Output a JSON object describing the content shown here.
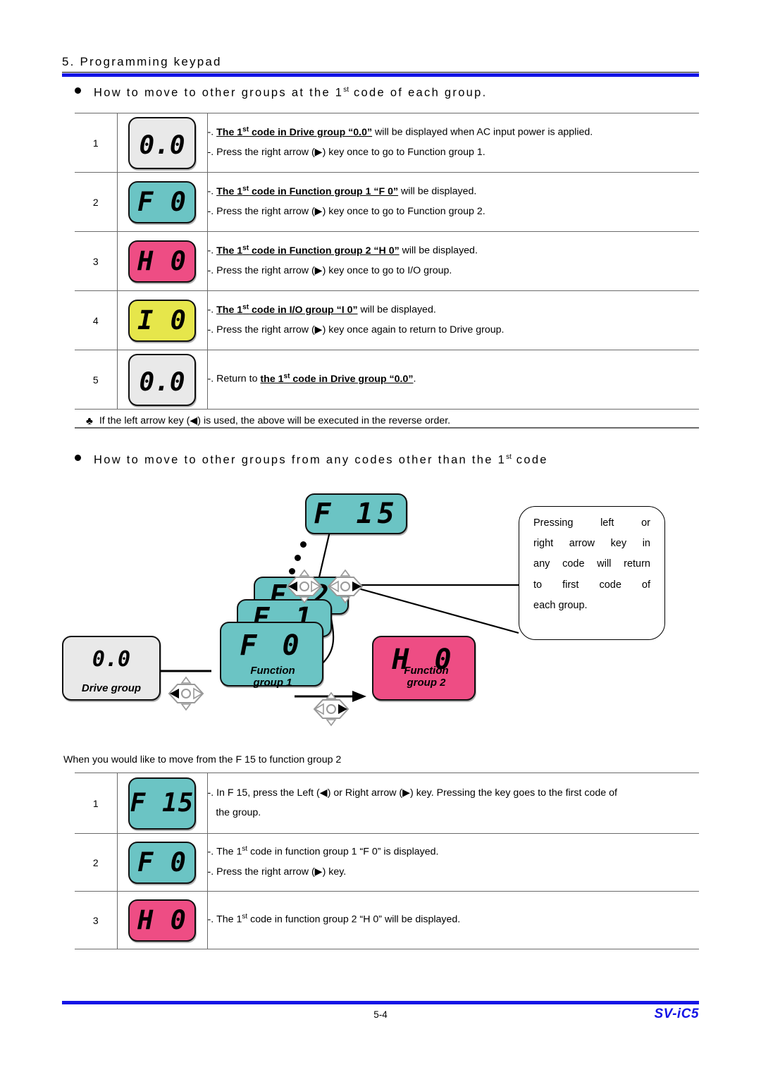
{
  "header": {
    "title": "5. Programming keypad"
  },
  "section1": {
    "heading_pre": "How to move to other groups at the 1",
    "heading_sup": "st",
    "heading_post": " code of each group.",
    "rows": [
      {
        "num": "1",
        "display": {
          "text": "0.0",
          "color": "gray",
          "style": "double"
        },
        "lines": [
          {
            "bold": "The 1st code in Drive group “0.0”",
            "rest": " will be displayed when AC input power is applied.",
            "prefix": "-. "
          },
          {
            "bold": "",
            "rest": "Press the right arrow (▶) key once to go to Function group 1.",
            "prefix": "-. "
          }
        ]
      },
      {
        "num": "2",
        "display": {
          "text": "F 0",
          "color": "teal",
          "style": "single"
        },
        "lines": [
          {
            "bold": "The 1st code in Function group 1 “F 0”",
            "rest": " will be displayed.",
            "prefix": "-. "
          },
          {
            "bold": "",
            "rest": "Press the right arrow (▶) key once to go to Function group 2.",
            "prefix": "-. "
          }
        ]
      },
      {
        "num": "3",
        "display": {
          "text": "H 0",
          "color": "pink",
          "style": "single"
        },
        "lines": [
          {
            "bold": "The 1st code in Function group 2 “H 0”",
            "rest": " will be displayed.",
            "prefix": "-. "
          },
          {
            "bold": "",
            "rest": "Press the right arrow (▶) key once to go to I/O group.",
            "prefix": "-. "
          }
        ]
      },
      {
        "num": "4",
        "display": {
          "text": "I 0",
          "color": "yellow",
          "style": "single"
        },
        "lines": [
          {
            "bold": "The 1st code in I/O group “I 0”",
            "rest": " will be displayed.",
            "prefix": "-. "
          },
          {
            "bold": "",
            "rest": "Press the right arrow (▶) key once again to return to Drive group.",
            "prefix": "-. "
          }
        ]
      },
      {
        "num": "5",
        "display": {
          "text": "0.0",
          "color": "gray",
          "style": "double"
        },
        "lines": [
          {
            "bold": "the 1st code in Drive group “0.0”",
            "rest": ".",
            "prefix": "-. Return to "
          }
        ]
      }
    ],
    "note": {
      "symbol": "♣",
      "text": "If the left arrow key (◀) is used, the above will be executed in the reverse order."
    }
  },
  "section2": {
    "heading_pre": "How to move to other groups from any codes other than the 1",
    "heading_sup": "st",
    "heading_post": " code",
    "diagram": {
      "f15": {
        "text": "F 15",
        "color": "teal"
      },
      "f2": {
        "text": "F 2",
        "color": "teal"
      },
      "f1": {
        "text": "F 1",
        "color": "teal"
      },
      "f0": {
        "text": "F 0",
        "color": "teal",
        "label1": "Function",
        "label2": "group 1"
      },
      "drive": {
        "text": "0.0",
        "color": "gray",
        "label1": "Drive group"
      },
      "h0": {
        "text": "H 0",
        "color": "pink",
        "label1": "Function",
        "label2": "group 2"
      },
      "callout": [
        "Pressing left or",
        "right arrow key in",
        "any code will return",
        "to first code of",
        "each group."
      ]
    },
    "caption": "When you would like to move from the F 15 to function group 2",
    "rows": [
      {
        "num": "1",
        "display": {
          "text": "F 15",
          "color": "teal",
          "style": "single"
        },
        "lines": [
          {
            "bold": "",
            "rest": "In F 15, press the Left (◀) or Right arrow (▶) key. Pressing the key goes to the first code of",
            "prefix": "-. "
          },
          {
            "bold": "",
            "rest": "the group.",
            "prefix": "   "
          }
        ]
      },
      {
        "num": "2",
        "display": {
          "text": "F 0",
          "color": "teal",
          "style": "single"
        },
        "lines": [
          {
            "bold": "",
            "rest": "The 1st code in function group 1 “F 0” is displayed.",
            "prefix": "-. "
          },
          {
            "bold": "",
            "rest": "Press the right arrow (▶) key.",
            "prefix": "-. "
          }
        ]
      },
      {
        "num": "3",
        "display": {
          "text": "H 0",
          "color": "pink",
          "style": "single"
        },
        "lines": [
          {
            "bold": "",
            "rest": "The 1st code in function group 2 “H 0” will be displayed.",
            "prefix": "-. "
          }
        ]
      }
    ]
  },
  "footer": {
    "page_number": "5-4",
    "model": "SV-iC5"
  },
  "colors": {
    "accent_blue": "#1414e6",
    "lcd_teal": "#6bc4c4",
    "lcd_pink": "#ee4d84",
    "lcd_yellow": "#e6e64b",
    "lcd_gray": "#e9e9e9"
  }
}
